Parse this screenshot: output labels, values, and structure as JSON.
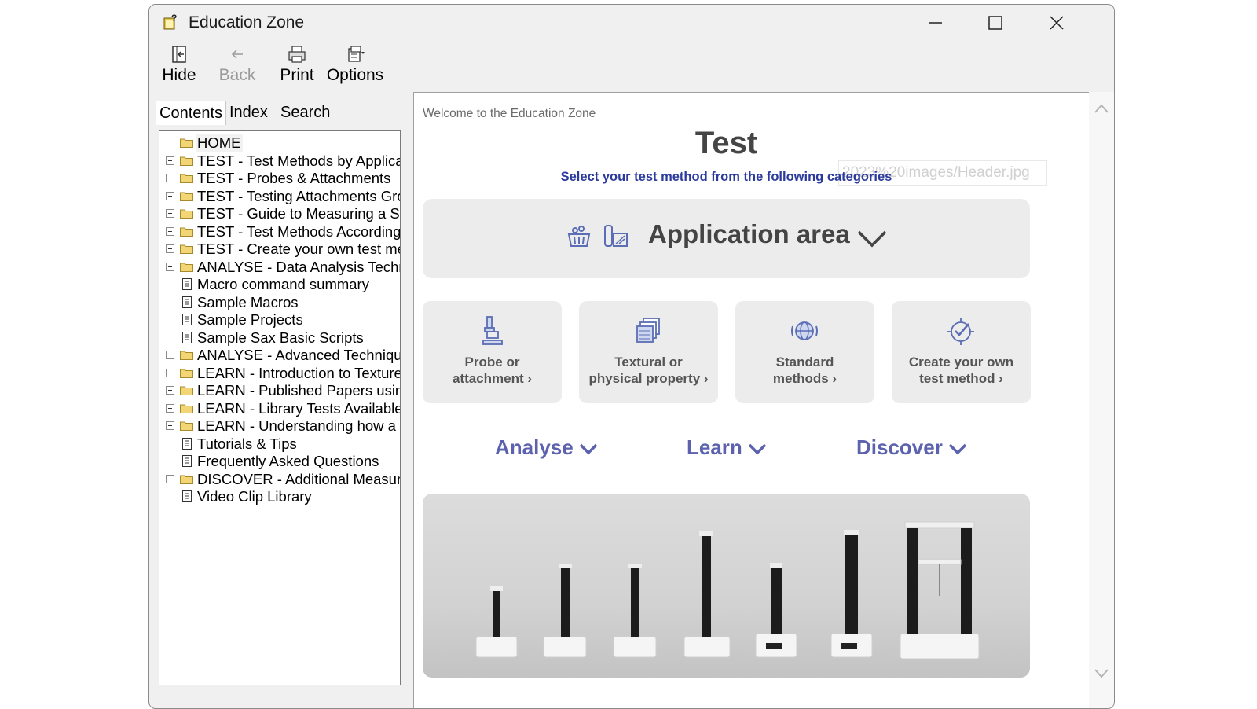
{
  "window": {
    "title": "Education Zone"
  },
  "toolbar": {
    "hide": "Hide",
    "back": "Back",
    "print": "Print",
    "options": "Options"
  },
  "tabs": {
    "contents": "Contents",
    "index": "Index",
    "search": "Search"
  },
  "tree": [
    {
      "label": "HOME",
      "kind": "folder",
      "expandable": false
    },
    {
      "label": "TEST - Test Methods by Applicati",
      "kind": "folder",
      "expandable": true
    },
    {
      "label": "TEST - Probes & Attachments",
      "kind": "folder",
      "expandable": true
    },
    {
      "label": "TEST - Testing Attachments Grou",
      "kind": "folder",
      "expandable": true
    },
    {
      "label": "TEST - Guide to Measuring a Spe",
      "kind": "folder",
      "expandable": true
    },
    {
      "label": "TEST - Test Methods According t",
      "kind": "folder",
      "expandable": true
    },
    {
      "label": "TEST - Create your own test meth",
      "kind": "folder",
      "expandable": true
    },
    {
      "label": "ANALYSE - Data Analysis Techni",
      "kind": "folder",
      "expandable": true
    },
    {
      "label": "Macro command summary",
      "kind": "page",
      "expandable": false
    },
    {
      "label": "Sample Macros",
      "kind": "page",
      "expandable": false
    },
    {
      "label": "Sample Projects",
      "kind": "page",
      "expandable": false
    },
    {
      "label": "Sample Sax Basic Scripts",
      "kind": "page",
      "expandable": false
    },
    {
      "label": "ANALYSE - Advanced Technique",
      "kind": "folder",
      "expandable": true
    },
    {
      "label": "LEARN - Introduction to Texture A",
      "kind": "folder",
      "expandable": true
    },
    {
      "label": "LEARN - Published Papers using",
      "kind": "folder",
      "expandable": true
    },
    {
      "label": "LEARN - Library Tests Available",
      "kind": "folder",
      "expandable": true
    },
    {
      "label": "LEARN - Understanding how a Te",
      "kind": "folder",
      "expandable": true
    },
    {
      "label": "Tutorials & Tips",
      "kind": "page",
      "expandable": false
    },
    {
      "label": "Frequently Asked Questions",
      "kind": "page",
      "expandable": false
    },
    {
      "label": "DISCOVER - Additional Measure",
      "kind": "folder",
      "expandable": true
    },
    {
      "label": "Video Clip Library",
      "kind": "page",
      "expandable": false
    }
  ],
  "content": {
    "welcome": "Welcome to the Education Zone",
    "heading": "Test",
    "subheading": "Select your test method from the following categories",
    "broken_image_text": "2023%20images/Header.jpg",
    "application_area": "Application area",
    "cards": [
      {
        "line1": "Probe or",
        "line2": "attachment ›",
        "icon": "probe-icon"
      },
      {
        "line1": "Textural or",
        "line2": "physical property ›",
        "icon": "texture-icon"
      },
      {
        "line1": "Standard",
        "line2": "methods ›",
        "icon": "globe-icon"
      },
      {
        "line1": "Create your own",
        "line2": "test method ›",
        "icon": "check-target-icon"
      }
    ],
    "nav": {
      "analyse": "Analyse",
      "learn": "Learn",
      "discover": "Discover"
    }
  },
  "colors": {
    "accent_blue": "#2b3a9c",
    "nav_purple": "#5c62ad",
    "card_bg": "#ececec"
  }
}
